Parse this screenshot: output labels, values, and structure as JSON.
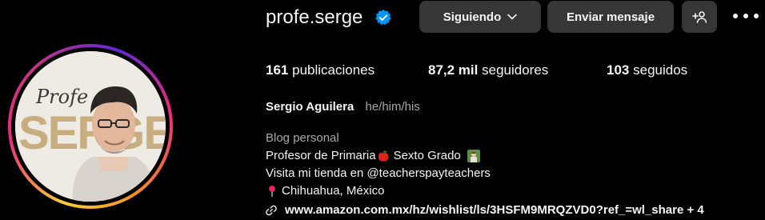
{
  "profile": {
    "username": "profe.serge",
    "verified_color": "#0095f6",
    "full_name": "Sergio Aguilera",
    "pronouns": "he/him/his",
    "avatar_text_top": "Profe",
    "avatar_text_main": "SERGE"
  },
  "actions": {
    "following_label": "Siguiendo",
    "message_label": "Enviar mensaje",
    "suggest_icon": "add-person-icon",
    "more_icon": "more-options-icon"
  },
  "stats": {
    "posts_count": "161",
    "posts_label": "publicaciones",
    "followers_count": "87,2 mil",
    "followers_label": "seguidores",
    "following_count": "103",
    "following_label": "seguidos"
  },
  "bio": {
    "category": "Blog personal",
    "line1_text": "Profesor de Primaria",
    "line1_suffix": "Sexto Grado",
    "line2": "Visita mi tienda en @teacherspayteachers",
    "location": "Chihuahua, México",
    "link_text": "www.amazon.com.mx/hz/wishlist/ls/3HSFM9MRQZVD0?ref_=wl_share + 4"
  },
  "colors": {
    "background": "#000000",
    "button": "#363636",
    "secondary_text": "#a8a8a8",
    "avatar_gold": "#c8ad7f"
  }
}
